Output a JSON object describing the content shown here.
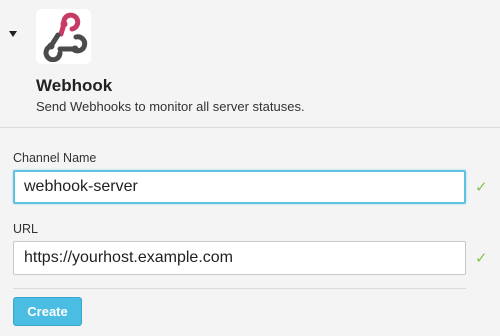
{
  "integration": {
    "title": "Webhook",
    "description": "Send Webhooks to monitor all server statuses.",
    "logo_icon": "webhook-icon",
    "logo_colors": [
      "#c73a63",
      "#4b4b4b"
    ]
  },
  "form": {
    "channel_name": {
      "label": "Channel Name",
      "value": "webhook-server",
      "valid": true
    },
    "url": {
      "label": "URL",
      "value": "https://yourhost.example.com",
      "valid": true
    },
    "create_label": "Create"
  },
  "colors": {
    "accent": "#4bbde3",
    "focus_border": "#5ec2e0",
    "valid_check": "#8cc152"
  },
  "icons": {
    "collapse": "caret-down-icon",
    "valid": "checkmark-icon"
  }
}
